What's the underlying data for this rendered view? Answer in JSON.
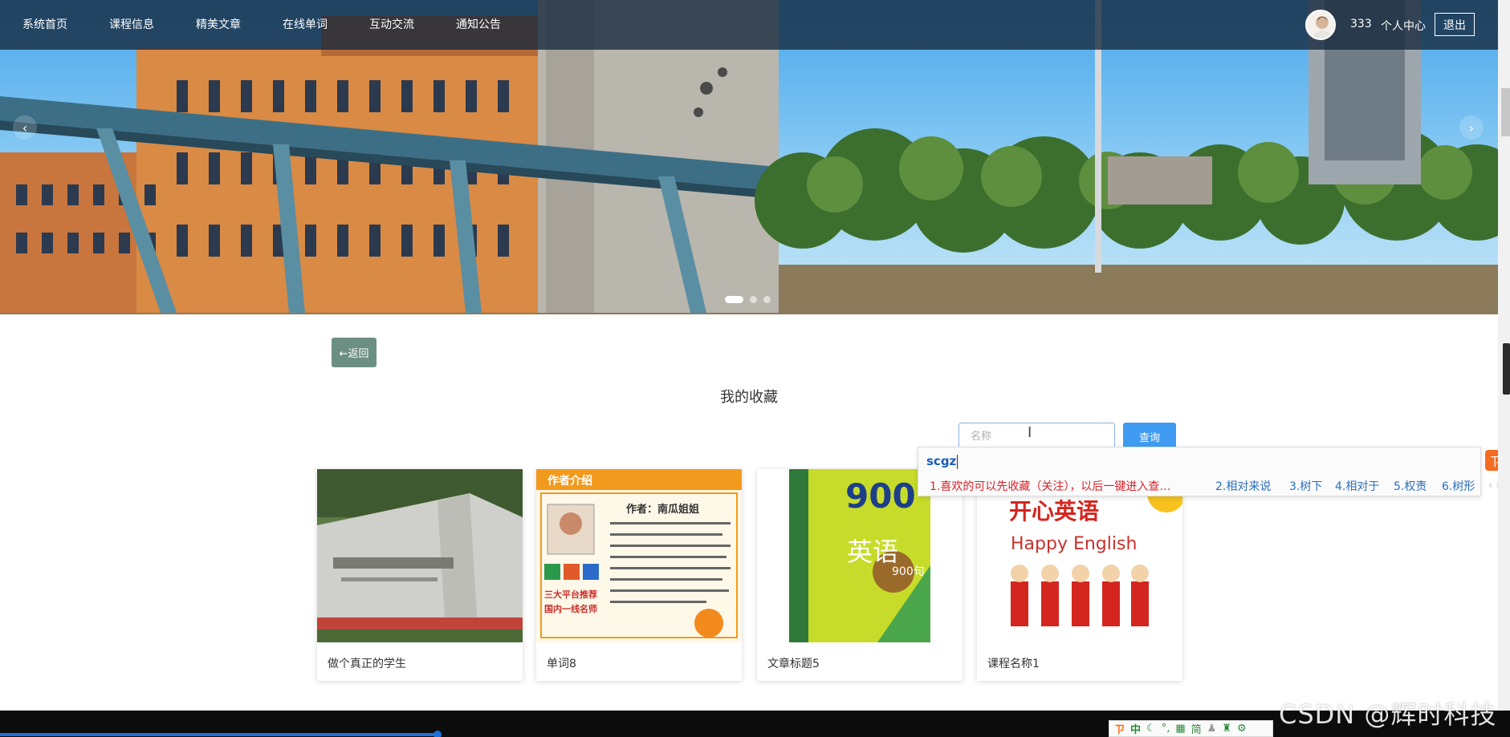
{
  "nav": {
    "items": [
      {
        "label": "系统首页"
      },
      {
        "label": "课程信息"
      },
      {
        "label": "精美文章"
      },
      {
        "label": "在线单词"
      },
      {
        "label": "互动交流"
      },
      {
        "label": "通知公告"
      }
    ],
    "username": "333",
    "user_center": "个人中心",
    "logout": "退出"
  },
  "carousel": {
    "prev_icon": "chevron-left-icon",
    "next_icon": "chevron-right-icon",
    "prev_glyph": "‹",
    "next_glyph": "›",
    "slide_count": 3,
    "active_index": 0
  },
  "back_button": "←返回",
  "page_title": "我的收藏",
  "search": {
    "placeholder": "名称",
    "button": "查询"
  },
  "cards": [
    {
      "caption": "做个真正的学生"
    },
    {
      "caption": "单词8"
    },
    {
      "caption": "文章标题5"
    },
    {
      "caption": "课程名称1"
    }
  ],
  "thumb_text": {
    "author_intro": "作者介绍",
    "author": "作者：南瓜姐姐",
    "platform": "三大平台推荐",
    "teacher": "国内一线名师",
    "book_num": "900",
    "book_title": "英语",
    "book_sub": "900句",
    "happy_title": "开心英语",
    "happy_en": "Happy English"
  },
  "ime": {
    "input": "scgz",
    "candidates": [
      "1.喜欢的可以先收藏（关注），以后一键进入查…",
      "2.相对来说",
      "3.树下",
      "4.相对于",
      "5.权责",
      "6.树形"
    ],
    "nav_glyph": "‹ ›",
    "logo_glyph": "ㄗ"
  },
  "ime_toolbar": [
    "中",
    "简"
  ],
  "watermark": "CSDN @辉时科技",
  "colors": {
    "nav_bg": "#14283c",
    "back_button": "#6c8f83",
    "search_button": "#3f9cf2",
    "ime_first": "#d9222a",
    "ime_rest": "#2a6fc0"
  }
}
